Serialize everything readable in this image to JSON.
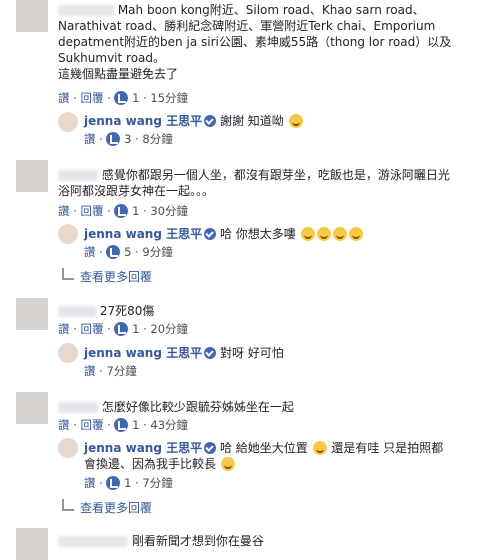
{
  "c1": {
    "line1": "Mah boon kong附近、Silom road、Khao sarn road、",
    "line2": "Narathivat road、勝利紀念碑附近、軍營附近Terk chai、Emporium",
    "line3": "depatment附近的ben ja siri公園、素坤威55路（thong lor road）以及",
    "line4": "Sukhumvit road。",
    "line5": "這幾個點盡量避免去了",
    "like": "讚",
    "reply": "回覆",
    "likes": "1",
    "time": "15分鐘"
  },
  "r1": {
    "name": "jenna wang 王思平",
    "text": "謝謝 知道呦",
    "like": "讚",
    "likes": "3",
    "time": "8分鐘"
  },
  "c2": {
    "line1": "感覺你都跟另一個人坐，都沒有跟芽坐，吃飯也是，游泳阿曬日光",
    "line2": "浴阿都沒跟芽女神在一起。。。",
    "like": "讚",
    "reply": "回覆",
    "likes": "1",
    "time": "30分鐘"
  },
  "r2": {
    "name": "jenna wang 王思平",
    "text": "哈 你想太多嘍",
    "like": "讚",
    "likes": "5",
    "time": "9分鐘"
  },
  "more1": "查看更多回覆",
  "c3": {
    "text": "27死80傷",
    "like": "讚",
    "reply": "回覆",
    "likes": "1",
    "time": "20分鐘"
  },
  "r3": {
    "name": "jenna wang 王思平",
    "text": "對呀 好可怕",
    "like": "讚",
    "time": "7分鐘"
  },
  "c4": {
    "text": "怎麼好像比較少跟毓芬姊姊坐在一起",
    "like": "讚",
    "reply": "回覆",
    "likes": "1",
    "time": "43分鐘"
  },
  "r4": {
    "name": "jenna wang 王思平",
    "text1": "哈 給她坐大位置",
    "text2": "還是有哇 只是拍照都",
    "line2": "會換邊、因為我手比較長",
    "like": "讚",
    "likes": "1",
    "time": "7分鐘"
  },
  "more2": "查看更多回覆",
  "c5": {
    "text": "剛看新聞才想到你在曼谷"
  },
  "icons": {
    "like": "thumbs-up-icon",
    "verified": "verified-badge-icon",
    "emoji": "smile-emoji-icon",
    "reply": "reply-arrow-icon"
  },
  "colors": {
    "link": "#365899",
    "like_blue": "#4267b2",
    "text": "#1d2129",
    "meta": "#4b4f56"
  }
}
